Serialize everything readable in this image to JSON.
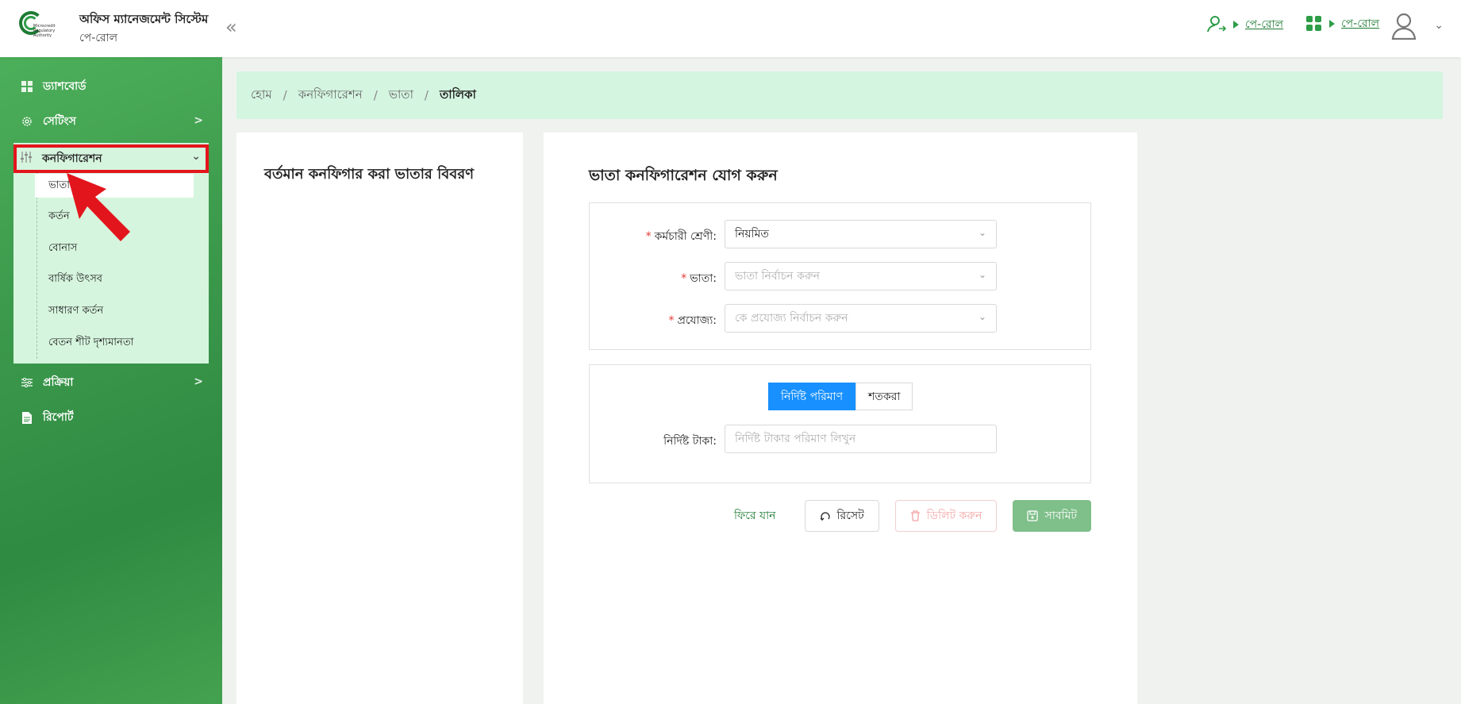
{
  "app": {
    "title": "অফিস ম্যানেজমেন্ট সিস্টেম",
    "subtitle": "পে-রোল",
    "logo_text": [
      "Microcredit",
      "Regulatory",
      "Authority"
    ]
  },
  "header": {
    "links": [
      {
        "icon": "user-switch-icon",
        "label": "পে-রোল"
      },
      {
        "icon": "apps-grid-icon",
        "label": "পে-রোল"
      }
    ]
  },
  "sidebar": {
    "items": [
      {
        "icon": "dashboard-icon",
        "label": "ড্যাশবোর্ড"
      },
      {
        "icon": "settings-icon",
        "label": "সেটিংস"
      },
      {
        "icon": "sliders-icon",
        "label": "কনফিগারেশন"
      },
      {
        "icon": "process-icon",
        "label": "প্রক্রিয়া"
      },
      {
        "icon": "report-icon",
        "label": "রিপোর্ট"
      }
    ],
    "config_children": [
      {
        "label": "ভাতা",
        "active": true
      },
      {
        "label": "কর্তন"
      },
      {
        "label": "বোনাস"
      },
      {
        "label": "বার্ষিক উৎসব"
      },
      {
        "label": "সাধারণ কর্তন"
      },
      {
        "label": "বেতন শীট দৃশ্যমানতা"
      }
    ]
  },
  "breadcrumb": [
    "হোম",
    "কনফিগারেশন",
    "ভাতা",
    "তালিকা"
  ],
  "left_card": {
    "title": "বর্তমান কনফিগার করা ভাতার বিবরণ"
  },
  "form": {
    "title": "ভাতা কনফিগারেশন যোগ করুন",
    "employee_class": {
      "label": "কর্মচারী শ্রেণী:",
      "value": "নিয়মিত"
    },
    "allowance": {
      "label": "ভাতা:",
      "placeholder": "ভাতা নির্বাচন করুন"
    },
    "applicable": {
      "label": "প্রযোজ্য:",
      "placeholder": "কে প্রযোজ্য নির্বাচন করুন"
    },
    "amount_type": {
      "options": [
        "নির্দিষ্ট পরিমাণ",
        "শতকরা"
      ],
      "selected": "নির্দিষ্ট পরিমাণ"
    },
    "fixed_amount": {
      "label": "নির্দিষ্ট টাকা:",
      "placeholder": "নির্দিষ্ট টাকার পরিমাণ লিখুন"
    }
  },
  "actions": {
    "back": "ফিরে যান",
    "reset": "রিসেট",
    "delete": "ডিলিট করুন",
    "submit": "সাবমিট"
  },
  "colors": {
    "brand_green": "#1e7a34",
    "sidebar_green": "#3c9a4c",
    "breadcrumb_bg": "#d4f5e0",
    "primary_blue": "#1890ff",
    "highlight_red": "#e3151c"
  }
}
